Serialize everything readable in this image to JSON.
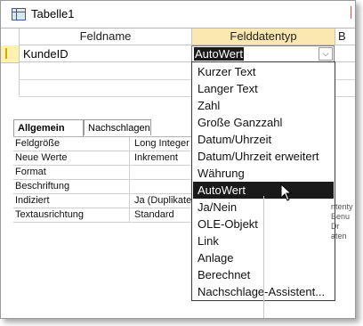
{
  "window": {
    "tab_title": "Tabelle1"
  },
  "grid": {
    "headers": {
      "fieldname": "Feldname",
      "datatype": "Felddatentyp",
      "description": "B"
    },
    "row": {
      "fieldname": "KundeID"
    }
  },
  "datatype_combo": {
    "selected": "AutoWert",
    "options": [
      "Kurzer Text",
      "Langer Text",
      "Zahl",
      "Große Ganzzahl",
      "Datum/Uhrzeit",
      "Datum/Uhrzeit erweitert",
      "Währung",
      "AutoWert",
      "Ja/Nein",
      "OLE-Objekt",
      "Link",
      "Anlage",
      "Berechnet",
      "Nachschlage-Assistent..."
    ]
  },
  "properties": {
    "tabs": [
      "Allgemein",
      "Nachschlagen"
    ],
    "rows": [
      {
        "label": "Feldgröße",
        "value": "Long Integer"
      },
      {
        "label": "Neue Werte",
        "value": "Inkrement"
      },
      {
        "label": "Format",
        "value": ""
      },
      {
        "label": "Beschriftung",
        "value": ""
      },
      {
        "label": "Indiziert",
        "value": "Ja (Duplikate"
      },
      {
        "label": "Textausrichtung",
        "value": "Standard"
      }
    ]
  },
  "help_fragment": [
    "ntenty",
    "Benu",
    "Dr",
    "aten"
  ],
  "colors": {
    "selection": "#1a1a1a",
    "row_selector": "#fff2b0"
  }
}
